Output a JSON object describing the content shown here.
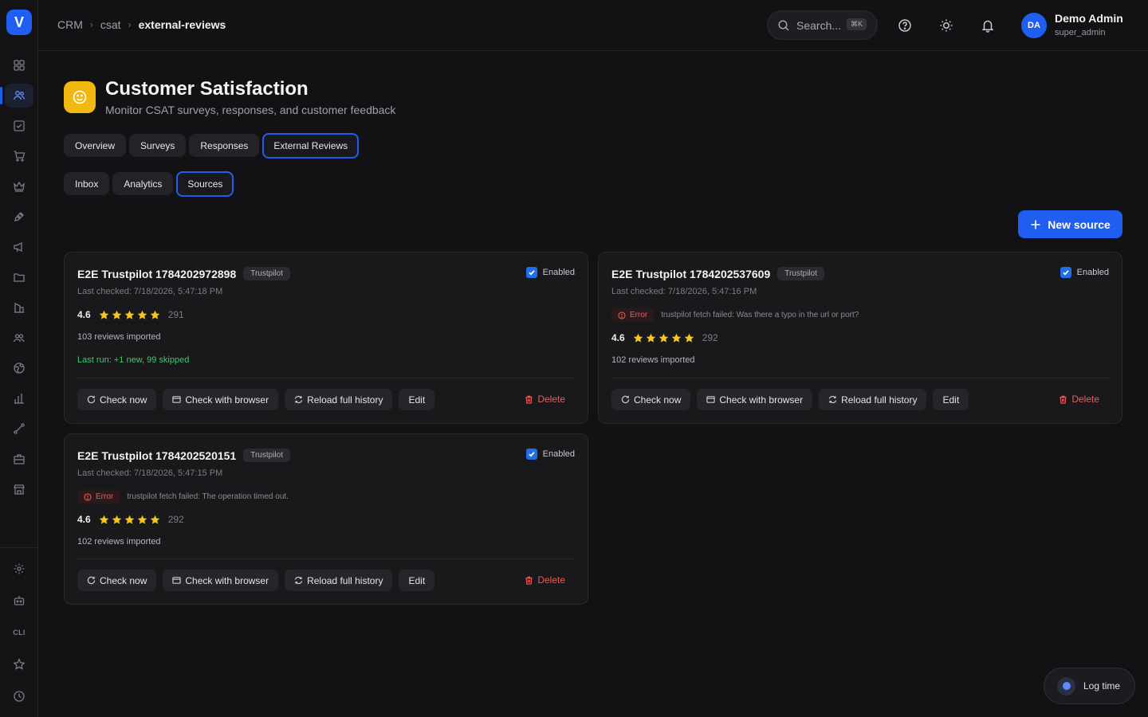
{
  "sidebar": {
    "logo": "V",
    "cli_label": "CLI",
    "items": [
      {
        "icon": "dashboard-icon"
      },
      {
        "icon": "users-icon",
        "active": true
      },
      {
        "icon": "checkbox-icon"
      },
      {
        "icon": "cart-icon"
      },
      {
        "icon": "crown-icon"
      },
      {
        "icon": "pen-icon"
      },
      {
        "icon": "megaphone-icon"
      },
      {
        "icon": "folder-icon"
      },
      {
        "icon": "building-icon"
      },
      {
        "icon": "team-icon"
      },
      {
        "icon": "globe-icon"
      },
      {
        "icon": "bar-chart-icon"
      },
      {
        "icon": "route-icon"
      },
      {
        "icon": "briefcase-icon"
      },
      {
        "icon": "store-icon"
      }
    ],
    "bottom": [
      {
        "icon": "settings-icon"
      },
      {
        "icon": "robot-icon"
      },
      {
        "icon": "cli-icon"
      },
      {
        "icon": "star-icon"
      },
      {
        "icon": "clock-icon"
      }
    ]
  },
  "header": {
    "breadcrumb": [
      "CRM",
      "csat",
      "external-reviews"
    ],
    "search_placeholder": "Search...",
    "search_shortcut": "⌘K",
    "user_name": "Demo Admin",
    "user_role": "super_admin",
    "user_initials": "DA"
  },
  "page": {
    "title": "Customer Satisfaction",
    "subtitle": "Monitor CSAT surveys, responses, and customer feedback"
  },
  "main_tabs": [
    {
      "label": "Overview",
      "active": false
    },
    {
      "label": "Surveys",
      "active": false
    },
    {
      "label": "Responses",
      "active": false
    },
    {
      "label": "External Reviews",
      "active": true
    }
  ],
  "sub_tabs": [
    {
      "label": "Inbox",
      "active": false
    },
    {
      "label": "Analytics",
      "active": false
    },
    {
      "label": "Sources",
      "active": true
    }
  ],
  "new_source_label": "New source",
  "cards": [
    {
      "name": "E2E Trustpilot 1784202972898",
      "platform": "Trustpilot",
      "enabled_label": "Enabled",
      "last_checked": "Last checked: 7/18/2026, 5:47:18 PM",
      "rating": "4.6",
      "stars": 5,
      "review_count": "291",
      "imported": "103 reviews imported",
      "last_run": "Last run: +1 new, 99 skipped"
    },
    {
      "name": "E2E Trustpilot 1784202537609",
      "platform": "Trustpilot",
      "enabled_label": "Enabled",
      "last_checked": "Last checked: 7/18/2026, 5:47:16 PM",
      "error_label": "Error",
      "error_message": "trustpilot fetch failed: Was there a typo in the url or port?",
      "rating": "4.6",
      "stars": 5,
      "review_count": "292",
      "imported": "102 reviews imported"
    },
    {
      "name": "E2E Trustpilot 1784202520151",
      "platform": "Trustpilot",
      "enabled_label": "Enabled",
      "last_checked": "Last checked: 7/18/2026, 5:47:15 PM",
      "error_label": "Error",
      "error_message": "trustpilot fetch failed: The operation timed out.",
      "rating": "4.6",
      "stars": 5,
      "review_count": "292",
      "imported": "102 reviews imported"
    }
  ],
  "actions": {
    "check_now": "Check now",
    "check_browser": "Check with browser",
    "reload_history": "Reload full history",
    "edit": "Edit",
    "delete": "Delete"
  },
  "log_time_label": "Log time",
  "colors": {
    "accent": "#1f5ef0",
    "title_icon_bg": "#f1b80f",
    "star": "#f6c71a",
    "success": "#3ec96a",
    "error": "#ef5a5a"
  }
}
